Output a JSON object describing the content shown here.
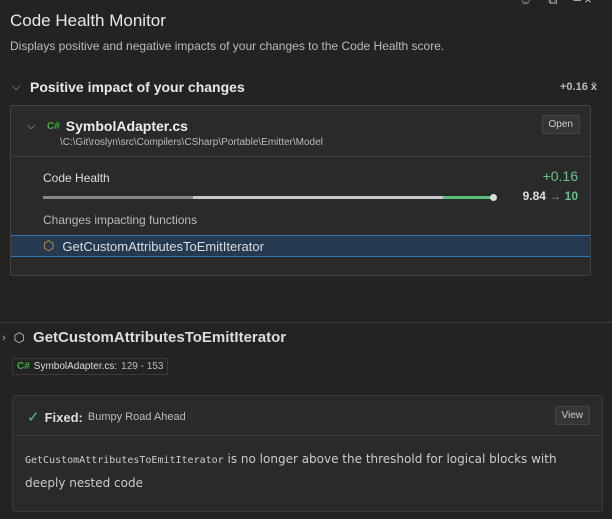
{
  "header": {
    "title": "Code Health Monitor",
    "description": "Displays positive and negative impacts of your changes to the Code Health score."
  },
  "section": {
    "title": "Positive impact of your changes",
    "value": "+0.16 x̄"
  },
  "file": {
    "lang": "C#",
    "name": "SymbolAdapter.cs",
    "path": "\\C:\\Git\\roslyn\\src\\Compilers\\CSharp\\Portable\\Emitter\\Model",
    "open_label": "Open",
    "code_health_label": "Code Health",
    "delta": "+0.16",
    "score_from": "9.84",
    "arrow": "→",
    "score_to": "10",
    "score_fraction": 0.984,
    "changes_label": "Changes impacting functions",
    "functions": [
      "GetCustomAttributesToEmitIterator"
    ]
  },
  "detail": {
    "function": "GetCustomAttributesToEmitIterator",
    "lang": "C#",
    "file": "SymbolAdapter.cs:",
    "lines": "129 - 153",
    "fix_label": "Fixed:",
    "fix_name": "Bumpy Road Ahead",
    "view_label": "View",
    "code": "GetCustomAttributesToEmitIterator",
    "message": " is no longer above the threshold for logical blocks with deeply nested code"
  }
}
